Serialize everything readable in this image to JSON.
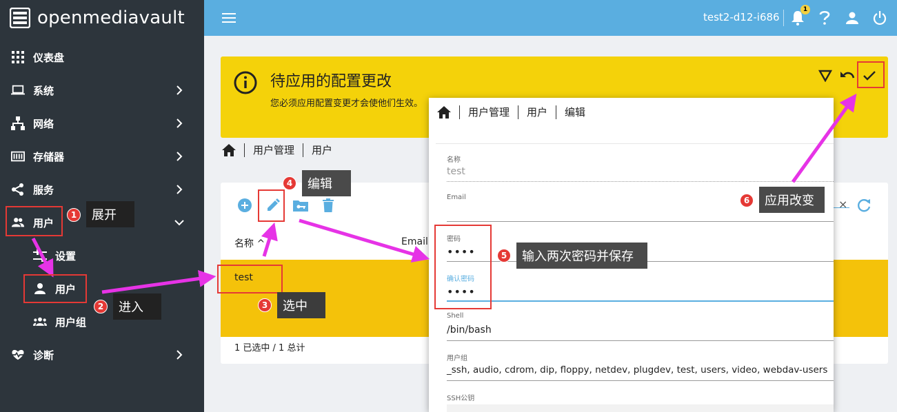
{
  "app": {
    "logo_text": "openmediavault",
    "hostname": "test2-d12-i686",
    "notification_count": "1"
  },
  "sidebar": {
    "items": [
      {
        "label": "仪表盘",
        "icon": "dashboard-icon"
      },
      {
        "label": "系统",
        "icon": "laptop-icon"
      },
      {
        "label": "网络",
        "icon": "network-icon"
      },
      {
        "label": "存储器",
        "icon": "storage-icon"
      },
      {
        "label": "服务",
        "icon": "share-icon"
      },
      {
        "label": "用户",
        "icon": "users-icon"
      },
      {
        "label": "设置",
        "icon": "settings-icon"
      },
      {
        "label": "用户",
        "icon": "user-icon"
      },
      {
        "label": "用户组",
        "icon": "group-icon"
      },
      {
        "label": "诊断",
        "icon": "heartbeat-icon"
      }
    ]
  },
  "banner": {
    "title": "待应用的配置更改",
    "subtitle": "您必须应用配置变更才会使他们生效。",
    "color": "#f4d20a"
  },
  "breadcrumb": {
    "items": [
      "用户管理",
      "用户"
    ]
  },
  "table": {
    "columns": [
      "名称",
      "Email"
    ],
    "rows": [
      {
        "name": "test"
      }
    ],
    "footer": "1 已选中 / 1 总计",
    "highlight_color": "#f4c20a"
  },
  "dialog": {
    "breadcrumb": [
      "用户管理",
      "用户",
      "编辑"
    ],
    "fields": {
      "name_label": "名称",
      "name_value": "test",
      "email_label": "Email",
      "email_value": "",
      "password_label": "密码",
      "password_value": "••••",
      "confirm_label": "确认密码",
      "confirm_value": "••••",
      "shell_label": "Shell",
      "shell_value": "/bin/bash",
      "groups_label": "用户组",
      "groups_value": "_ssh, audio, cdrom, dip, floppy, netdev, plugdev, test, users, video, webdav-users",
      "sshkey_label": "SSH公钥"
    }
  },
  "annotations": {
    "step1": {
      "num": "1",
      "text": "展开"
    },
    "step2": {
      "num": "2",
      "text": "进入"
    },
    "step3": {
      "num": "3",
      "text": "选中"
    },
    "step4": {
      "num": "4",
      "text": "编辑"
    },
    "step5": {
      "num": "5",
      "text": "输入两次密码并保存"
    },
    "step6": {
      "num": "6",
      "text": "应用改变"
    },
    "arrow_color": "#e633e6",
    "box_color": "#e53935"
  },
  "colors": {
    "sidebar": "#2d353c",
    "topbar": "#5aaee0",
    "accent": "#5aaee0"
  }
}
